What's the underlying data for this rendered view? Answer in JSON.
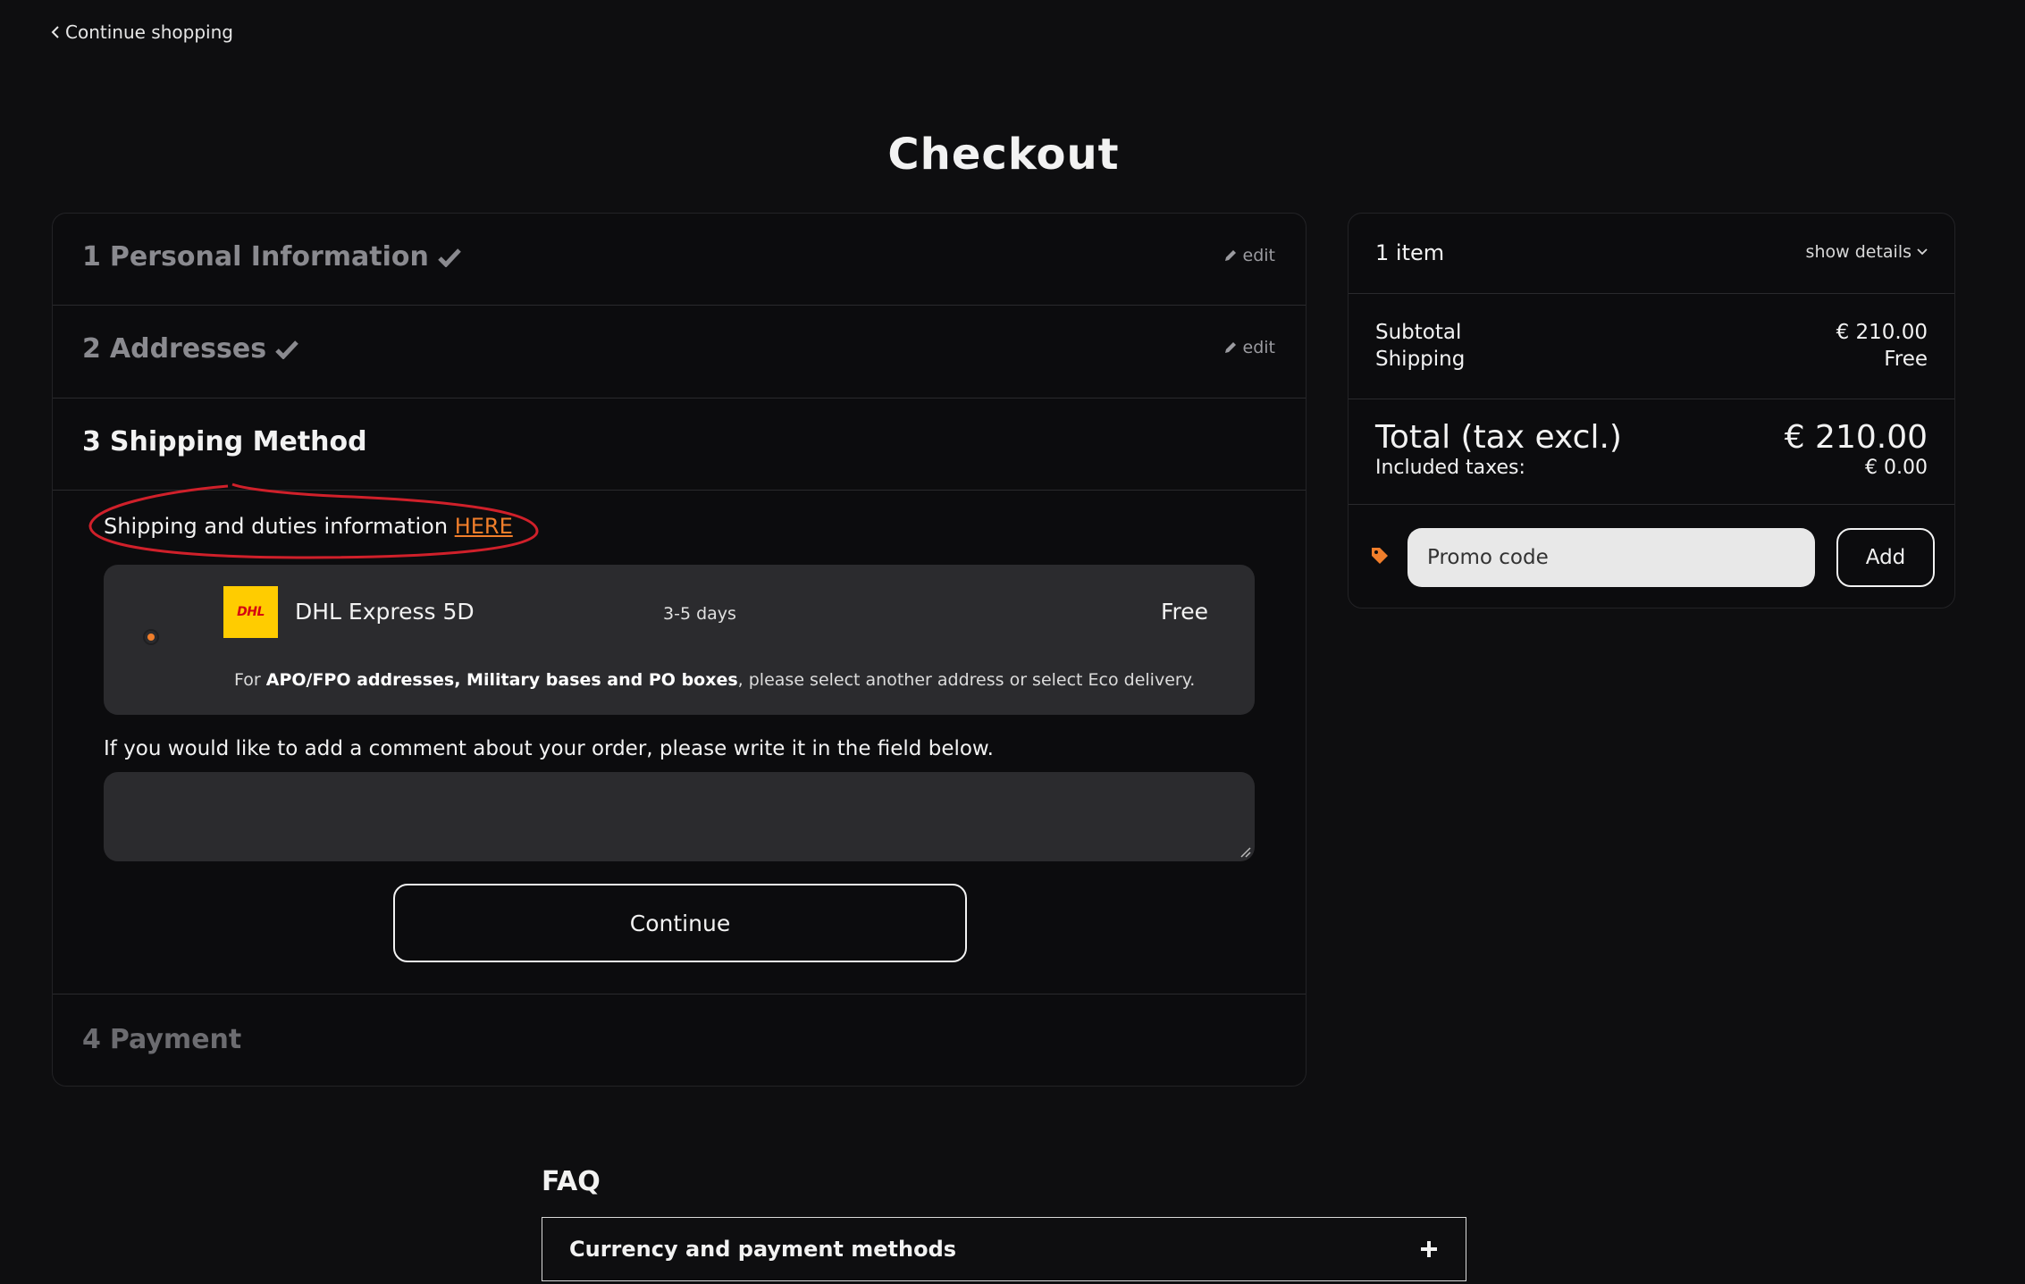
{
  "back_link": {
    "label": "Continue shopping"
  },
  "page_title": "Checkout",
  "steps": [
    {
      "number": "1",
      "title": "Personal Information",
      "status": "complete",
      "edit_label": "edit"
    },
    {
      "number": "2",
      "title": "Addresses",
      "status": "complete",
      "edit_label": "edit"
    },
    {
      "number": "3",
      "title": "Shipping Method",
      "status": "current"
    },
    {
      "number": "4",
      "title": "Payment",
      "status": "upcoming"
    }
  ],
  "shipping": {
    "info_text": "Shipping and duties information",
    "info_link": "HERE",
    "carrier": {
      "logo_text": "DHL",
      "name": "DHL Express 5D",
      "delay": "3-5 days",
      "price": "Free",
      "selected": true,
      "note_prefix": "For ",
      "note_bold": "APO/FPO addresses, Military bases and PO boxes",
      "note_suffix": ", please select another address or select Eco delivery."
    },
    "comment_label": "If you would like to add a comment about your order, please write it in the field below.",
    "comment_value": "",
    "continue_label": "Continue"
  },
  "summary": {
    "items_count": "1 item",
    "show_details": "show details",
    "subtotal_label": "Subtotal",
    "subtotal_value": "€ 210.00",
    "shipping_label": "Shipping",
    "shipping_value": "Free",
    "total_label": "Total (tax excl.)",
    "total_value": "€ 210.00",
    "taxes_label": "Included taxes:",
    "taxes_value": "€ 0.00",
    "promo_placeholder": "Promo code",
    "promo_add": "Add"
  },
  "faq": {
    "title": "FAQ",
    "items": [
      {
        "label": "Currency and payment methods"
      }
    ]
  },
  "colors": {
    "accent": "#f07e2b",
    "background": "#0e0e10",
    "panel": "#2b2b2e",
    "annotation": "#d0202a"
  }
}
